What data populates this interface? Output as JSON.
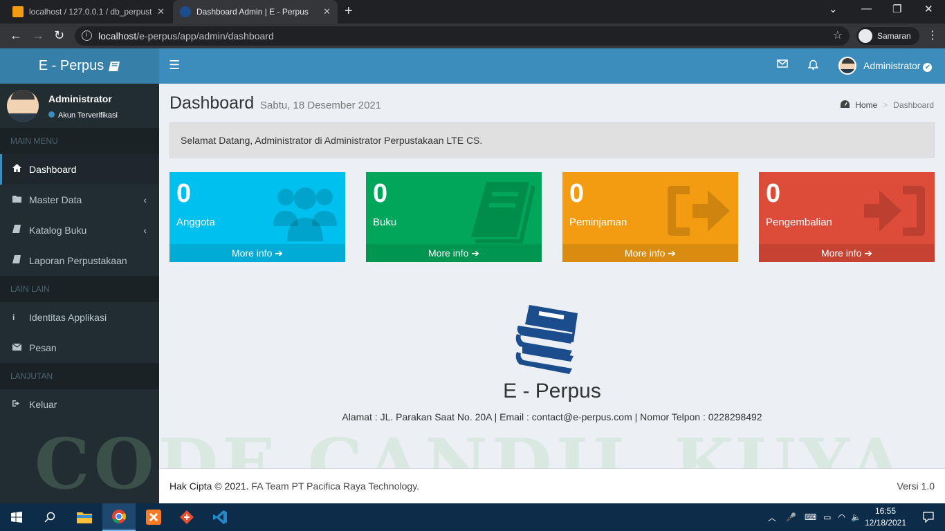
{
  "browser": {
    "tabs": [
      {
        "title": "localhost / 127.0.0.1 / db_perpust",
        "close": "✕"
      },
      {
        "title": "Dashboard Admin | E - Perpus",
        "close": "✕"
      }
    ],
    "url_host": "localhost",
    "url_path": "/e-perpus/app/admin/dashboard",
    "profile_label": "Samaran"
  },
  "app": {
    "brand": "E - Perpus",
    "topbar_user": "Administrator",
    "sidebar": {
      "user_name": "Administrator",
      "user_status": "Akun Terverifikasi",
      "sections": {
        "main": "MAIN MENU",
        "other": "LAIN LAIN",
        "next": "LANJUTAN"
      },
      "main_items": [
        {
          "label": "Dashboard",
          "icon": "home-icon"
        },
        {
          "label": "Master Data",
          "icon": "folder-icon"
        },
        {
          "label": "Katalog Buku",
          "icon": "book-icon"
        },
        {
          "label": "Laporan Perpustakaan",
          "icon": "book-icon"
        }
      ],
      "other_items": [
        {
          "label": "Identitas Applikasi",
          "icon": "info-icon"
        },
        {
          "label": "Pesan",
          "icon": "envelope-icon"
        }
      ],
      "next_items": [
        {
          "label": "Keluar",
          "icon": "sign-out-icon"
        }
      ]
    },
    "content": {
      "title": "Dashboard",
      "subtitle": "Sabtu, 18 Desember 2021",
      "breadcrumb": {
        "home": "Home",
        "sep": ">",
        "current": "Dashboard"
      },
      "welcome": "Selamat Datang, Administrator di Administrator Perpustakaan LTE CS.",
      "stats": [
        {
          "value": "0",
          "label": "Anggota",
          "more": "More info ➔",
          "color": "#00c0ef",
          "icon": "users-icon"
        },
        {
          "value": "0",
          "label": "Buku",
          "more": "More info ➔",
          "color": "#00a65a",
          "icon": "book-icon"
        },
        {
          "value": "0",
          "label": "Peminjaman",
          "more": "More info ➔",
          "color": "#f39c12",
          "icon": "sign-out-icon"
        },
        {
          "value": "0",
          "label": "Pengembalian",
          "more": "More info ➔",
          "color": "#dd4b39",
          "icon": "sign-in-icon"
        }
      ],
      "brand_large": "E - Perpus",
      "address": "Alamat : JL. Parakan Saat No. 20A | Email : contact@e-perpus.com | Nomor Telpon : 0228298492",
      "watermark": "CODE CANDIL KUYA"
    },
    "footer": {
      "copyright_prefix": "Hak Cipta © 2021.",
      "copyright_suffix": "FA Team PT Pacifica Raya Technology.",
      "version": "Versi 1.0"
    }
  },
  "taskbar": {
    "time": "16:55",
    "date": "12/18/2021"
  },
  "colors": {
    "topbar": "#3c8dbc",
    "logo_bg": "#367fa9",
    "sidebar": "#222d32",
    "content_bg": "#ecf0f5",
    "logo_icon": "#1b4d8c"
  }
}
